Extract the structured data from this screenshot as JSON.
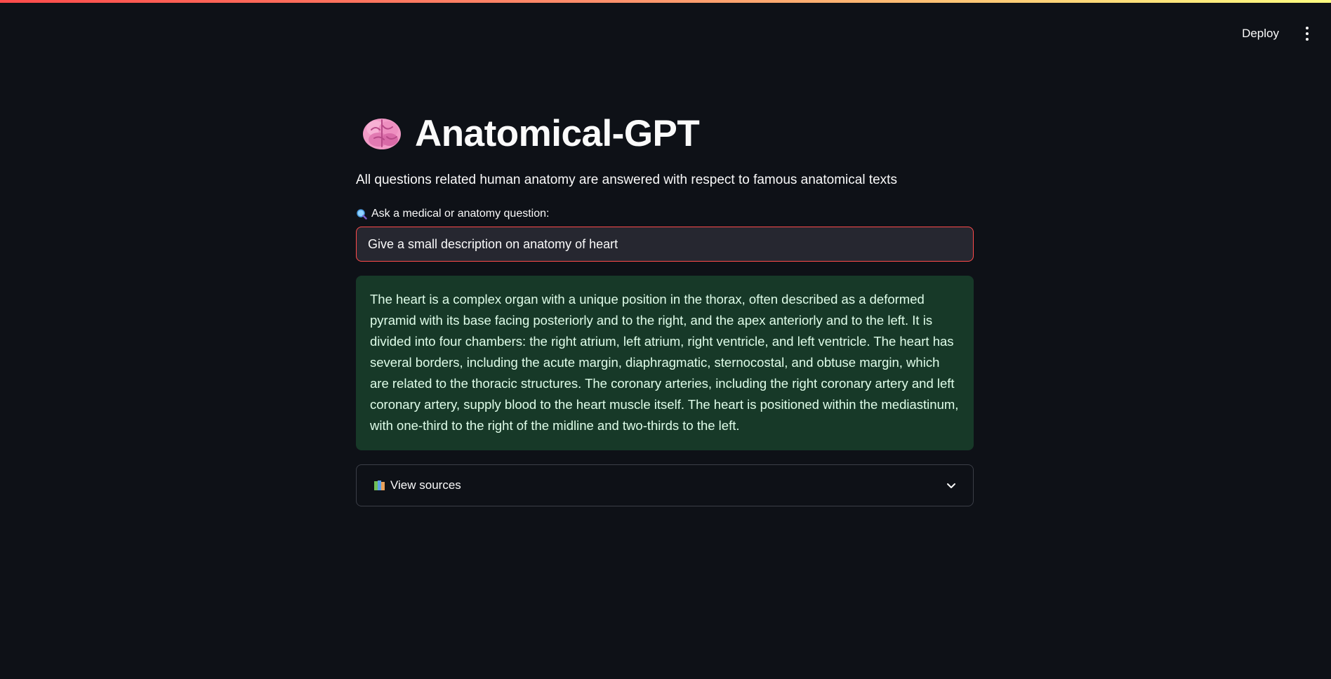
{
  "header": {
    "deploy_label": "Deploy",
    "menu_icon": "kebab-menu-icon"
  },
  "page": {
    "title": "Anatomical-GPT",
    "title_icon": "brain-icon",
    "subtitle": "All questions related human anatomy are answered with respect to famous anatomical texts"
  },
  "query": {
    "label": "Ask a medical or anatomy question:",
    "label_icon": "magnifier-icon",
    "value": "Give a small description on anatomy of heart"
  },
  "answer": {
    "text": "The heart is a complex organ with a unique position in the thorax, often described as a deformed pyramid with its base facing posteriorly and to the right, and the apex anteriorly and to the left. It is divided into four chambers: the right atrium, left atrium, right ventricle, and left ventricle. The heart has several borders, including the acute margin, diaphragmatic, sternocostal, and obtuse margin, which are related to the thoracic structures. The coronary arteries, including the right coronary artery and left coronary artery, supply blood to the heart muscle itself. The heart is positioned within the mediastinum, with one-third to the right of the midline and two-thirds to the left."
  },
  "sources": {
    "label": "View sources",
    "icon": "books-icon",
    "expanded": false
  },
  "colors": {
    "background": "#0e1117",
    "accent": "#ff4b4b",
    "answer_bg": "#173928",
    "answer_text": "#dffde9"
  }
}
